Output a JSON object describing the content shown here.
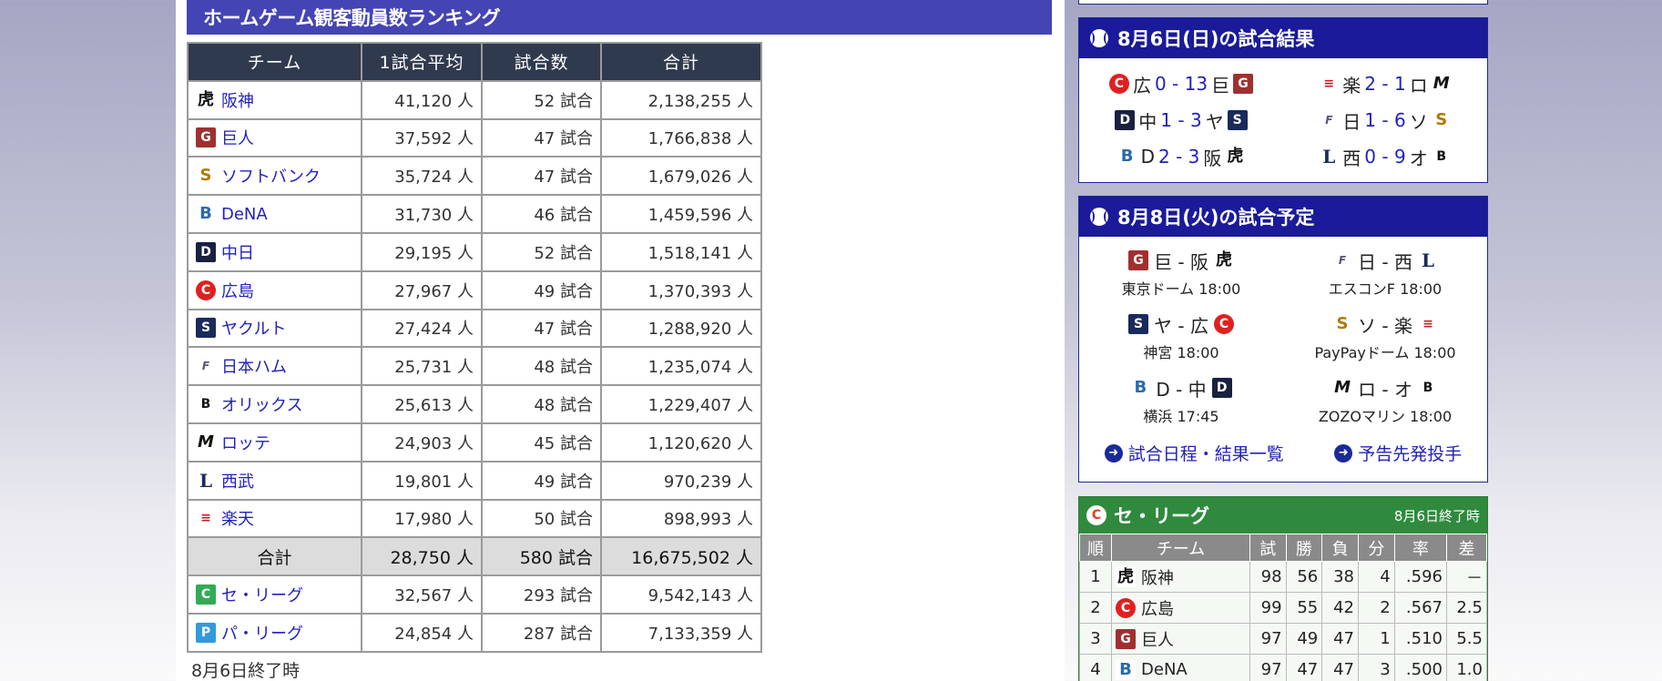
{
  "ranking": {
    "title": "ホームゲーム観客動員数ランキング",
    "headers": [
      "チーム",
      "1試合平均",
      "試合数",
      "合計"
    ],
    "rows": [
      {
        "team": "阪神",
        "avg": "41,120 人",
        "games": "52 試合",
        "total": "2,138,255 人",
        "logo": "tigers-icon"
      },
      {
        "team": "巨人",
        "avg": "37,592 人",
        "games": "47 試合",
        "total": "1,766,838 人",
        "logo": "giants-icon"
      },
      {
        "team": "ソフトバンク",
        "avg": "35,724 人",
        "games": "47 試合",
        "total": "1,679,026 人",
        "logo": "hawks-icon"
      },
      {
        "team": "DeNA",
        "avg": "31,730 人",
        "games": "46 試合",
        "total": "1,459,596 人",
        "logo": "baystars-icon"
      },
      {
        "team": "中日",
        "avg": "29,195 人",
        "games": "52 試合",
        "total": "1,518,141 人",
        "logo": "dragons-icon"
      },
      {
        "team": "広島",
        "avg": "27,967 人",
        "games": "49 試合",
        "total": "1,370,393 人",
        "logo": "carp-icon"
      },
      {
        "team": "ヤクルト",
        "avg": "27,424 人",
        "games": "47 試合",
        "total": "1,288,920 人",
        "logo": "swallows-icon"
      },
      {
        "team": "日本ハム",
        "avg": "25,731 人",
        "games": "48 試合",
        "total": "1,235,074 人",
        "logo": "fighters-icon"
      },
      {
        "team": "オリックス",
        "avg": "25,613 人",
        "games": "48 試合",
        "total": "1,229,407 人",
        "logo": "buffaloes-icon"
      },
      {
        "team": "ロッテ",
        "avg": "24,903 人",
        "games": "45 試合",
        "total": "1,120,620 人",
        "logo": "marines-icon"
      },
      {
        "team": "西武",
        "avg": "19,801 人",
        "games": "49 試合",
        "total": "970,239 人",
        "logo": "lions-icon"
      },
      {
        "team": "楽天",
        "avg": "17,980 人",
        "games": "50 試合",
        "total": "898,993 人",
        "logo": "eagles-icon"
      }
    ],
    "total": {
      "label": "合計",
      "avg": "28,750 人",
      "games": "580 試合",
      "total": "16,675,502 人"
    },
    "leagues": [
      {
        "team": "セ・リーグ",
        "avg": "32,567 人",
        "games": "293 試合",
        "total": "9,542,143 人",
        "logo": "central-league-icon"
      },
      {
        "team": "パ・リーグ",
        "avg": "24,854 人",
        "games": "287 試合",
        "total": "7,133,359 人",
        "logo": "pacific-league-icon"
      }
    ],
    "footnote": "8月6日終了時"
  },
  "results": {
    "title": "8月6日(日)の試合結果",
    "games": [
      {
        "home": "広",
        "score": "0 - 13",
        "away": "巨"
      },
      {
        "home": "楽",
        "score": "2 - 1",
        "away": "ロ"
      },
      {
        "home": "中",
        "score": "1 - 3",
        "away": "ヤ"
      },
      {
        "home": "日",
        "score": "1 - 6",
        "away": "ソ"
      },
      {
        "home": "D",
        "score": "2 - 3",
        "away": "阪"
      },
      {
        "home": "西",
        "score": "0 - 9",
        "away": "オ"
      }
    ]
  },
  "schedule": {
    "title": "8月8日(火)の試合予定",
    "games": [
      {
        "matchup": "巨 - 阪",
        "venue": "東京ドーム 18:00"
      },
      {
        "matchup": "日 - 西",
        "venue": "エスコンF 18:00"
      },
      {
        "matchup": "ヤ - 広",
        "venue": "神宮 18:00"
      },
      {
        "matchup": "ソ - 楽",
        "venue": "PayPayドーム 18:00"
      },
      {
        "matchup": "D - 中",
        "venue": "横浜 17:45"
      },
      {
        "matchup": "ロ - オ",
        "venue": "ZOZOマリン 18:00"
      }
    ],
    "link_schedule": "試合日程・結果一覧",
    "link_pitchers": "予告先発投手"
  },
  "standings": {
    "title": "セ・リーグ",
    "updated": "8月6日終了時",
    "headers": [
      "順",
      "チーム",
      "試",
      "勝",
      "負",
      "分",
      "率",
      "差"
    ],
    "rows": [
      {
        "rank": "1",
        "team": "阪神",
        "g": "98",
        "w": "56",
        "l": "38",
        "d": "4",
        "pct": ".596",
        "gb": "－"
      },
      {
        "rank": "2",
        "team": "広島",
        "g": "99",
        "w": "55",
        "l": "42",
        "d": "2",
        "pct": ".567",
        "gb": "2.5"
      },
      {
        "rank": "3",
        "team": "巨人",
        "g": "97",
        "w": "49",
        "l": "47",
        "d": "1",
        "pct": ".510",
        "gb": "5.5"
      },
      {
        "rank": "4",
        "team": "DeNA",
        "g": "97",
        "w": "47",
        "l": "47",
        "d": "3",
        "pct": ".500",
        "gb": "1.0"
      }
    ]
  }
}
